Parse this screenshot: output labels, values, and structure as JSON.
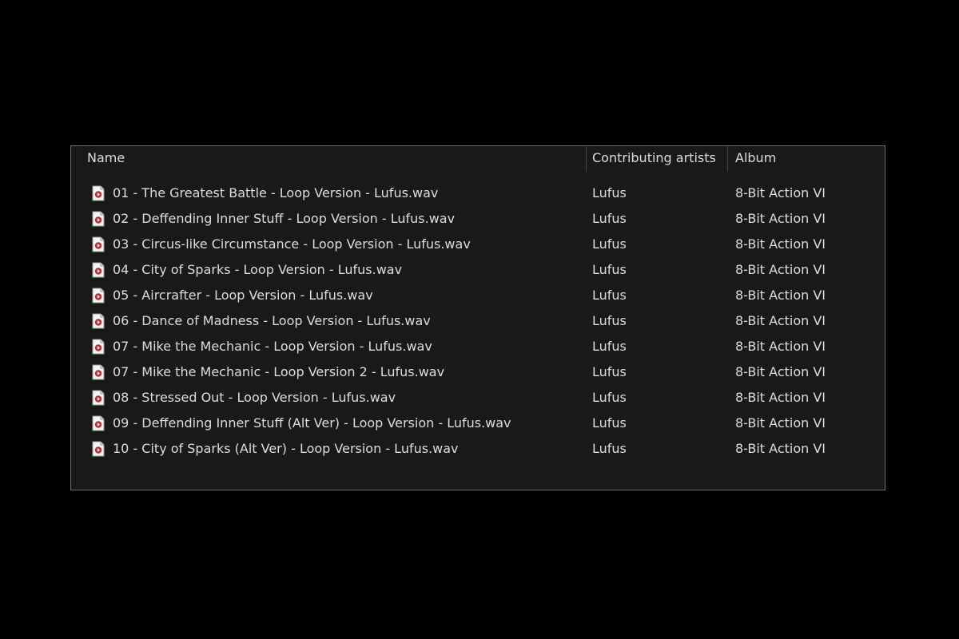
{
  "colors": {
    "background": "#000000",
    "panel": "#191919",
    "panel_border": "#6e6e6e",
    "text": "#dddddd",
    "icon_accent": "#c0282f"
  },
  "columns": {
    "name": "Name",
    "contributing_artists": "Contributing artists",
    "album": "Album"
  },
  "icon": "audio-file-icon",
  "files": [
    {
      "name": "01 - The Greatest Battle - Loop Version - Lufus.wav",
      "artist": "Lufus",
      "album": "8-Bit Action VI"
    },
    {
      "name": "02 - Deffending Inner Stuff - Loop Version - Lufus.wav",
      "artist": "Lufus",
      "album": "8-Bit Action VI"
    },
    {
      "name": "03 - Circus-like Circumstance - Loop Version - Lufus.wav",
      "artist": "Lufus",
      "album": "8-Bit Action VI"
    },
    {
      "name": "04 - City of Sparks - Loop Version - Lufus.wav",
      "artist": "Lufus",
      "album": "8-Bit Action VI"
    },
    {
      "name": "05 - Aircrafter - Loop Version - Lufus.wav",
      "artist": "Lufus",
      "album": "8-Bit Action VI"
    },
    {
      "name": "06 - Dance of Madness - Loop Version - Lufus.wav",
      "artist": "Lufus",
      "album": "8-Bit Action VI"
    },
    {
      "name": "07 - Mike the Mechanic - Loop Version - Lufus.wav",
      "artist": "Lufus",
      "album": "8-Bit Action VI"
    },
    {
      "name": "07 - Mike the Mechanic - Loop Version 2 - Lufus.wav",
      "artist": "Lufus",
      "album": "8-Bit Action VI"
    },
    {
      "name": "08 - Stressed Out - Loop Version - Lufus.wav",
      "artist": "Lufus",
      "album": "8-Bit Action VI"
    },
    {
      "name": "09 - Deffending Inner Stuff (Alt Ver) - Loop Version - Lufus.wav",
      "artist": "Lufus",
      "album": "8-Bit Action VI"
    },
    {
      "name": "10 - City of Sparks (Alt Ver) - Loop Version - Lufus.wav",
      "artist": "Lufus",
      "album": "8-Bit Action VI"
    }
  ]
}
